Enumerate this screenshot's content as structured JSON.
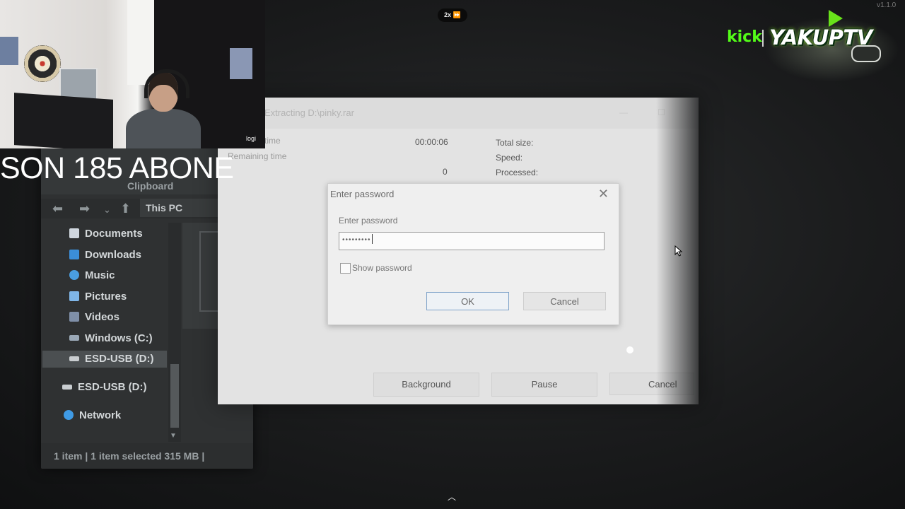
{
  "overlay": {
    "speed_badge": "2x ⏩",
    "subscriber_banner": "SON 185 ABONE",
    "webcam_brand": "logi",
    "version": "v1.1.0",
    "logo": {
      "platform": "kick",
      "channel": "YAKUPTV"
    }
  },
  "explorer": {
    "ribbon_group": "Clipboard",
    "breadcrumb": "This PC",
    "nav_icons": [
      "back-arrow-icon",
      "forward-arrow-icon",
      "chevron-down-icon",
      "up-arrow-icon"
    ],
    "tree": [
      {
        "label": "Documents",
        "icon": "documents-icon",
        "color": "#cfd6de"
      },
      {
        "label": "Downloads",
        "icon": "downloads-icon",
        "color": "#3b8ed8"
      },
      {
        "label": "Music",
        "icon": "music-icon",
        "color": "#4a9ee0"
      },
      {
        "label": "Pictures",
        "icon": "pictures-icon",
        "color": "#7fb6e8"
      },
      {
        "label": "Videos",
        "icon": "videos-icon",
        "color": "#7f8fa8"
      },
      {
        "label": "Windows (C:)",
        "icon": "drive-icon",
        "color": "#9aa8b6"
      },
      {
        "label": "ESD-USB (D:)",
        "icon": "usb-drive-icon",
        "color": "#c9cdd0",
        "selected": true
      },
      {
        "label": "ESD-USB (D:)",
        "icon": "usb-drive-icon",
        "color": "#c9cdd0"
      },
      {
        "label": "Network",
        "icon": "network-icon",
        "color": "#3f9be6"
      }
    ],
    "status": "1 item   |   1 item selected  315 MB   |"
  },
  "extraction": {
    "title": "Extracting D:\\pinky.rar",
    "elapsed_label": "time",
    "elapsed_value": "00:00:06",
    "remaining_label": "Remaining time",
    "count_value": "0",
    "total_size_label": "Total size:",
    "speed_label": "Speed:",
    "processed_label": "Processed:",
    "buttons": {
      "background": "Background",
      "pause": "Pause",
      "cancel": "Cancel"
    }
  },
  "password_dialog": {
    "title": "Enter password",
    "field_label": "Enter password",
    "field_value": "•••••••••",
    "show_password_label": "Show password",
    "show_password_checked": false,
    "ok_label": "OK",
    "cancel_label": "Cancel"
  }
}
